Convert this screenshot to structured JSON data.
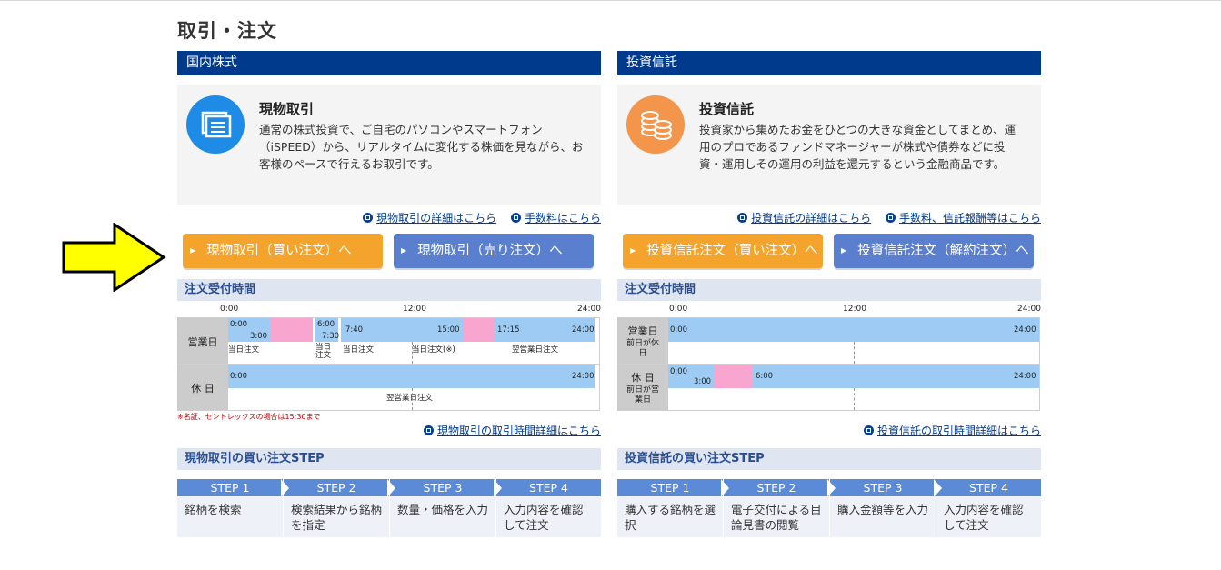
{
  "page_title": "取引・注文",
  "colors": {
    "header_navy": "#003a8c",
    "orange": "#f4a32c",
    "blue_button": "#5b7fcf",
    "bar_blue": "#9dcbf4",
    "bar_pink": "#f8a6d0",
    "arrow_yellow": "#ffff00"
  },
  "left": {
    "section_title": "国内株式",
    "icon": "document-stack-icon",
    "info_title": "現物取引",
    "info_desc": "通常の株式投資で、ご自宅のパソコンやスマートフォン（iSPEED）から、リアルタイムに変化する株価を見ながら、お客様のペースで行えるお取引です。",
    "link1": "現物取引の詳細はこちら",
    "link2": "手数料はこちら",
    "btn_buy": "現物取引（買い注文）へ",
    "btn_sell": "現物取引（売り注文）へ",
    "schedule_title": "注文受付時間",
    "hours": [
      "0:00",
      "12:00",
      "24:00"
    ],
    "row1_label": "営業日",
    "row1_times": [
      "0:00",
      "3:00",
      "6:00",
      "7:30",
      "7:40",
      "15:00",
      "17:15",
      "24:00"
    ],
    "row1_notes": [
      "当日注文",
      "当日注文",
      "当日注文",
      "当日注文(※)",
      "翌営業日注文"
    ],
    "row2_label": "休 日",
    "row2_times": [
      "0:00",
      "24:00"
    ],
    "row2_note": "翌営業日注文",
    "footnote": "※名証、セントレックスの場合は15:30まで",
    "schedule_link": "現物取引の取引時間詳細はこちら",
    "step_title": "現物取引の買い注文STEP",
    "steps": [
      {
        "tab": "STEP 1",
        "text": "銘柄を検索"
      },
      {
        "tab": "STEP 2",
        "text": "検索結果から銘柄を指定"
      },
      {
        "tab": "STEP 3",
        "text": "数量・価格を入力"
      },
      {
        "tab": "STEP 4",
        "text": "入力内容を確認して注文"
      }
    ]
  },
  "right": {
    "section_title": "投資信託",
    "icon": "coin-stack-icon",
    "info_title": "投資信託",
    "info_desc": "投資家から集めたお金をひとつの大きな資金としてまとめ、運用のプロであるファンドマネージャーが株式や債券などに投資・運用しその運用の利益を還元するという金融商品です。",
    "link1": "投資信託の詳細はこちら",
    "link2": "手数料、信託報酬等はこちら",
    "btn_buy": "投資信託注文（買い注文）へ",
    "btn_sell": "投資信託注文（解約注文）へ",
    "schedule_title": "注文受付時間",
    "hours": [
      "0:00",
      "12:00",
      "24:00"
    ],
    "row1_label": "営業日",
    "row1_sub": "前日が休日",
    "row1_times": [
      "0:00",
      "24:00"
    ],
    "row2_label": "休 日",
    "row2_sub": "前日が営業日",
    "row2_times": [
      "0:00",
      "3:00",
      "6:00",
      "24:00"
    ],
    "schedule_link": "投資信託の取引時間詳細はこちら",
    "step_title": "投資信託の買い注文STEP",
    "steps": [
      {
        "tab": "STEP 1",
        "text": "購入する銘柄を選択"
      },
      {
        "tab": "STEP 2",
        "text": "電子交付による目論見書の閲覧"
      },
      {
        "tab": "STEP 3",
        "text": "購入金額等を入力"
      },
      {
        "tab": "STEP 4",
        "text": "入力内容を確認して注文"
      }
    ]
  }
}
